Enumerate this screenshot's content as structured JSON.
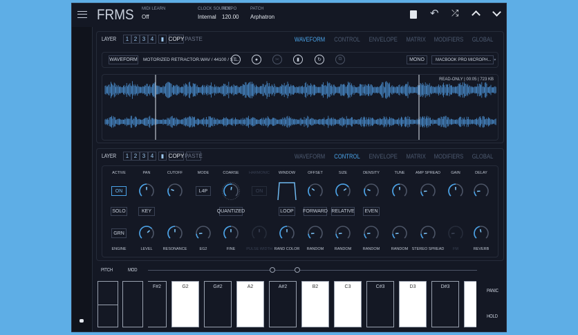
{
  "header": {
    "title": "FRMS",
    "fields": [
      {
        "label": "MIDI LEARN",
        "value": "Off"
      },
      {
        "label": "CLOCK SOURCE",
        "value": "Internal"
      },
      {
        "label": "TEMPO",
        "value": "120.00"
      },
      {
        "label": "PATCH",
        "value": "Arphatron"
      }
    ]
  },
  "layer_bar": {
    "label": "LAYER",
    "numbers": [
      "1",
      "2",
      "3",
      "4"
    ],
    "copy": "COPY",
    "paste": "PASTE",
    "tabs": [
      "WAVEFORM",
      "CONTROL",
      "ENVELOPE",
      "MATRIX",
      "MODIFIERS",
      "GLOBAL"
    ]
  },
  "waveform_bar": {
    "button": "WAVEFORM",
    "file": "MOTORIZED RETRACTOR.WAV / 44100 / ST...",
    "mono": "MONO",
    "input": "MACBOOK PRO MICROPH...",
    "info": "READ-ONLY | 00:05 | 723 KB"
  },
  "controls": [
    {
      "top": "ACTIVE",
      "ctl": "button",
      "btn": "ON",
      "active": true,
      "mid": "SOLO",
      "bctl": "button",
      "bbtn": "GRN",
      "bottom": "ENGINE"
    },
    {
      "top": "PAN",
      "ctl": "knob",
      "v": 0.5,
      "mid": "KEY",
      "bctl": "knob",
      "bv": 0.68,
      "bottom": "LEVEL"
    },
    {
      "top": "CUTOFF",
      "ctl": "knob",
      "v": 0.25,
      "bctl": "knob",
      "bv": 0.5,
      "bottom": "RESONANCE"
    },
    {
      "top": "MODE",
      "ctl": "button",
      "btn": "L4P",
      "bctl": "knob",
      "bv": 0.15,
      "bottom": "EG2"
    },
    {
      "top": "COARSE",
      "ctl": "knob",
      "v": 0.53,
      "mid": "QUANTIZED",
      "bctl": "knob",
      "bv": 0.5,
      "bottom": "FINE"
    },
    {
      "top": "HARMONIC",
      "dim": true,
      "ctl": "button",
      "btn": "ON",
      "bctl": "knob",
      "bv": 0.5,
      "bottom": "PULSE WIDTH"
    },
    {
      "top": "WINDOW",
      "ctl": "window",
      "mid": "LOOP",
      "bctl": "knob",
      "bv": 0.5,
      "bottom": "RAND COLOR"
    },
    {
      "top": "OFFSET",
      "ctl": "knob",
      "v": 0.3,
      "mid": "FORWARD",
      "bctl": "knob",
      "bv": 0.15,
      "bottom": "RANDOM"
    },
    {
      "top": "SIZE",
      "ctl": "knob",
      "v": 0.7,
      "mid": "RELATIVE",
      "bctl": "knob",
      "bv": 0.15,
      "bottom": "RANDOM"
    },
    {
      "top": "DENSITY",
      "ctl": "knob",
      "v": 0.25,
      "mid": "EVEN",
      "bctl": "knob",
      "bv": 0.15,
      "bottom": "RANDOM"
    },
    {
      "top": "TUNE",
      "ctl": "knob",
      "v": 0.5,
      "bctl": "knob",
      "bv": 0.15,
      "bottom": "RANDOM"
    },
    {
      "top": "AMP SPREAD",
      "ctl": "knob",
      "v": 0.15,
      "bctl": "knob",
      "bv": 0.15,
      "bottom": "STEREO SPREAD"
    },
    {
      "top": "GAIN",
      "ctl": "knob",
      "v": 0.5,
      "bctl": "knob",
      "bv": 0.15,
      "bdim": true,
      "bottom": "FM"
    },
    {
      "top": "DELAY",
      "ctl": "knob",
      "v": 0.15,
      "bctl": "knob",
      "bv": 0.45,
      "bottom": "REVERB"
    }
  ],
  "keyboard": {
    "pitch": "PITCH",
    "mod": "MOD",
    "keys": [
      {
        "n": "F#2",
        "w": false
      },
      {
        "n": "G2",
        "w": true
      },
      {
        "n": "G#2",
        "w": false
      },
      {
        "n": "A2",
        "w": true
      },
      {
        "n": "A#2",
        "w": false
      },
      {
        "n": "B2",
        "w": true
      },
      {
        "n": "C3",
        "w": true
      },
      {
        "n": "C#3",
        "w": false
      },
      {
        "n": "D3",
        "w": true
      },
      {
        "n": "D#3",
        "w": false
      },
      {
        "n": "",
        "w": true
      }
    ],
    "panic": "PANIC",
    "hold": "HOLD"
  },
  "colors": {
    "accent": "#4aa3e8",
    "bg": "#141824",
    "page": "#5eaee6"
  }
}
